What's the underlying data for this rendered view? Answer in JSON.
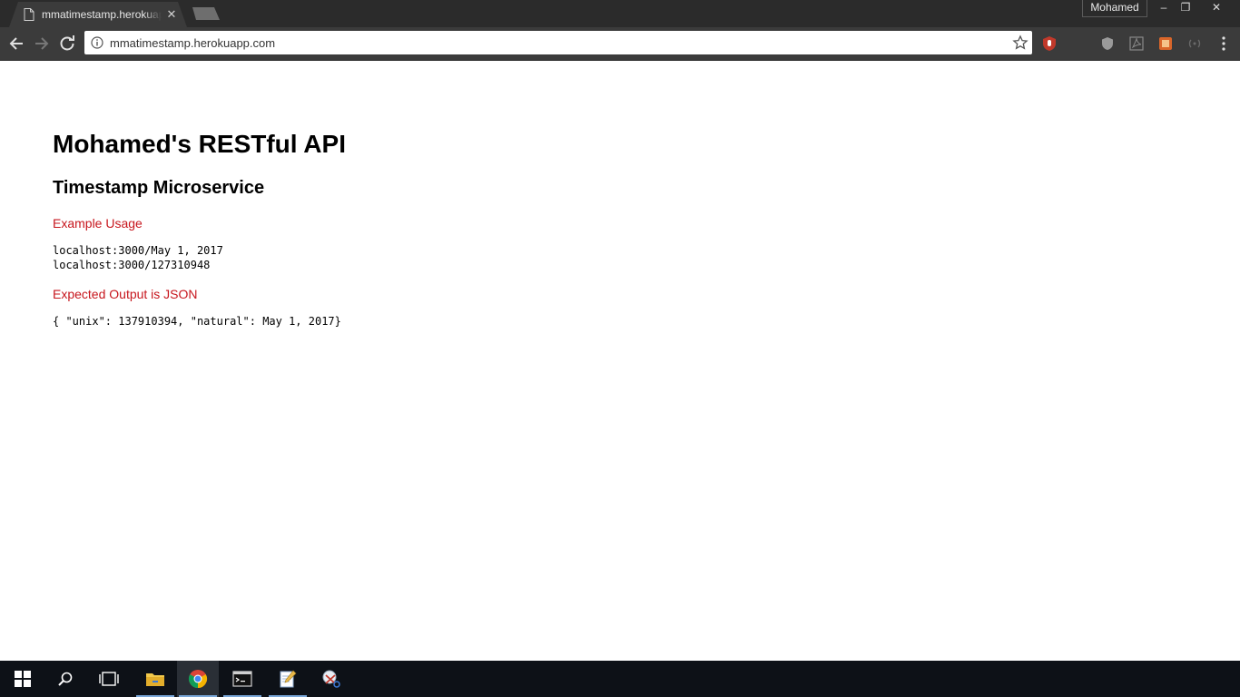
{
  "browser": {
    "tab": {
      "title": "mmatimestamp.herokuapp.com"
    },
    "profile_name": "Mohamed",
    "window_controls": {
      "minimize": "–",
      "maximize": "❐",
      "close": "✕"
    },
    "address_bar": {
      "url": "mmatimestamp.herokuapp.com"
    },
    "icons": [
      "page-icon",
      "close-icon",
      "back-arrow-icon",
      "forward-arrow-icon",
      "reload-icon",
      "info-icon",
      "star-icon",
      "ublock-icon",
      "shield-icon",
      "pdf-icon",
      "extension-icon",
      "cast-icon",
      "menu-icon"
    ]
  },
  "page": {
    "title": "Mohamed's RESTful API",
    "subtitle": "Timestamp Microservice",
    "example_label": "Example Usage",
    "example_lines": [
      "localhost:3000/May 1, 2017",
      "localhost:3000/127310948"
    ],
    "output_label": "Expected Output is JSON",
    "output_example": "{ \"unix\": 137910394, \"natural\": May 1, 2017}"
  },
  "taskbar": {
    "items": [
      "windows-start-icon",
      "search-icon",
      "task-view-icon",
      "file-explorer-icon",
      "chrome-icon",
      "command-prompt-icon",
      "notepad-icon",
      "snipping-tool-icon"
    ]
  },
  "colors": {
    "accent_label": "#c7161d",
    "chrome_dark": "#3b3b3b",
    "taskbar": "#0d1117"
  }
}
